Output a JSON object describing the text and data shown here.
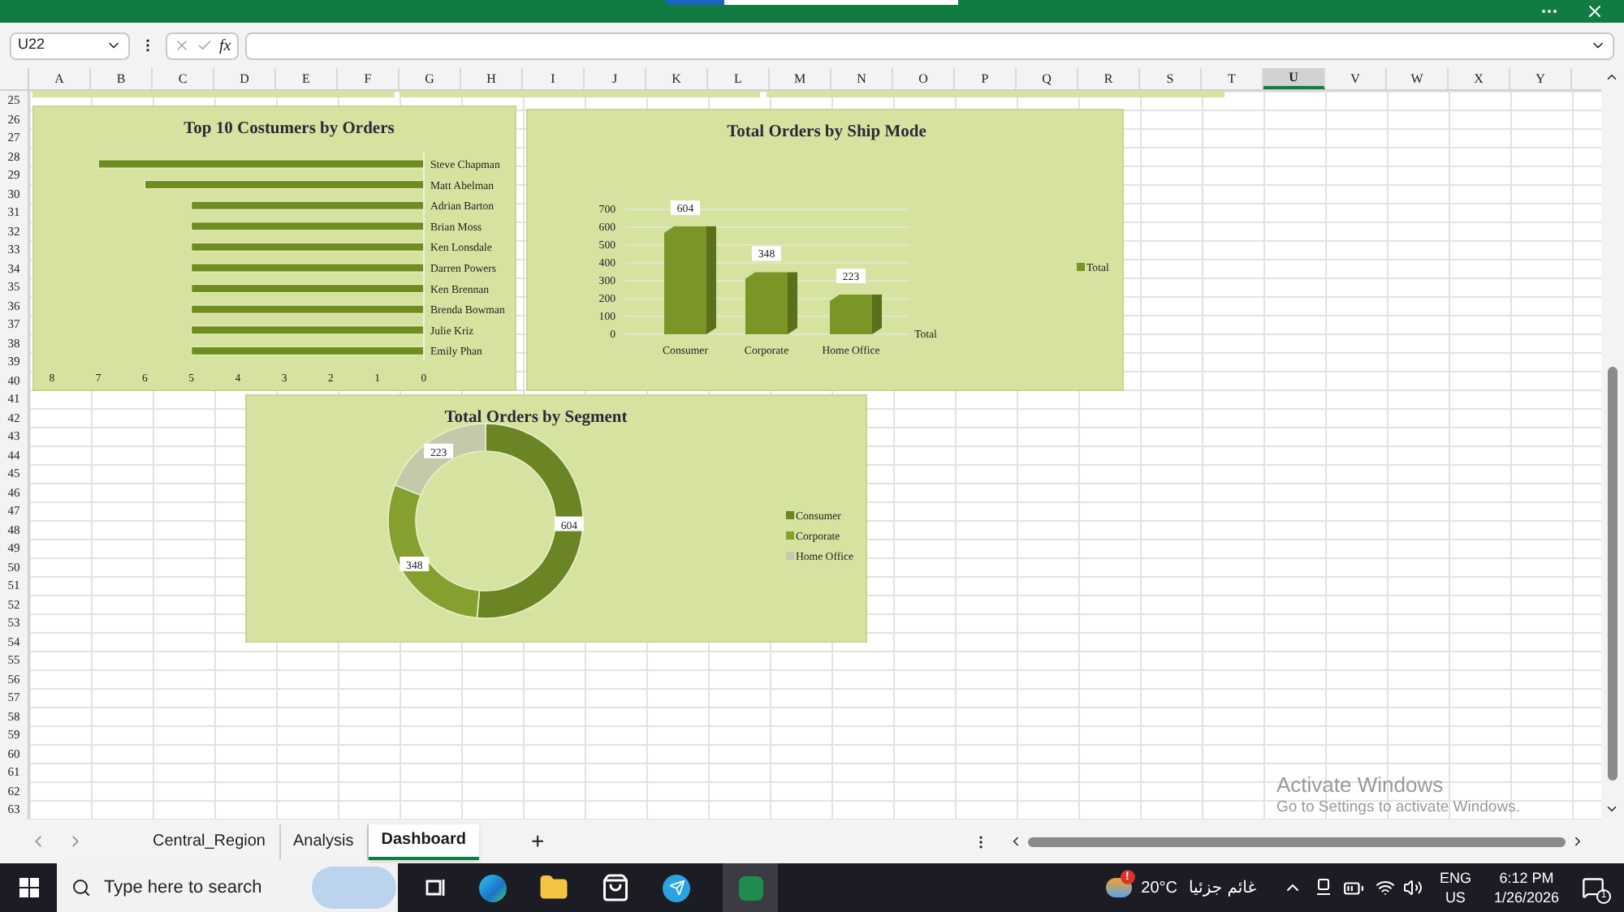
{
  "formula_bar": {
    "name_box": "U22",
    "function_label": "fx"
  },
  "columns": [
    {
      "label": "A",
      "selected": false
    },
    {
      "label": "B",
      "selected": false
    },
    {
      "label": "C",
      "selected": false
    },
    {
      "label": "D",
      "selected": false
    },
    {
      "label": "E",
      "selected": false
    },
    {
      "label": "F",
      "selected": false
    },
    {
      "label": "G",
      "selected": false
    },
    {
      "label": "H",
      "selected": false
    },
    {
      "label": "I",
      "selected": false
    },
    {
      "label": "J",
      "selected": false
    },
    {
      "label": "K",
      "selected": false
    },
    {
      "label": "L",
      "selected": false
    },
    {
      "label": "M",
      "selected": false
    },
    {
      "label": "N",
      "selected": false
    },
    {
      "label": "O",
      "selected": false
    },
    {
      "label": "P",
      "selected": false
    },
    {
      "label": "Q",
      "selected": false
    },
    {
      "label": "R",
      "selected": false
    },
    {
      "label": "S",
      "selected": false
    },
    {
      "label": "T",
      "selected": false
    },
    {
      "label": "U",
      "selected": true
    },
    {
      "label": "V",
      "selected": false
    },
    {
      "label": "W",
      "selected": false
    },
    {
      "label": "X",
      "selected": false
    },
    {
      "label": "Y",
      "selected": false
    }
  ],
  "rows": [
    "25",
    "26",
    "27",
    "28",
    "29",
    "30",
    "31",
    "32",
    "33",
    "34",
    "35",
    "36",
    "37",
    "38",
    "39",
    "40",
    "41",
    "42",
    "43",
    "44",
    "45",
    "46",
    "47",
    "48",
    "49",
    "50",
    "51",
    "52",
    "53",
    "54",
    "55",
    "56",
    "57",
    "58",
    "59",
    "60",
    "61",
    "62",
    "63"
  ],
  "customers_chart": {
    "chart_data": {
      "type": "bar",
      "orientation": "horizontal",
      "title": "Top 10 Costumers by Orders",
      "categories": [
        "Steve Chapman",
        "Matt Abelman",
        "Adrian Barton",
        "Brian Moss",
        "Ken Lonsdale",
        "Darren Powers",
        "Ken Brennan",
        "Brenda Bowman",
        "Julie Kriz",
        "Emily Phan"
      ],
      "values": [
        7,
        6,
        5,
        5,
        5,
        5,
        5,
        5,
        5,
        5
      ],
      "xticks": [
        8,
        7,
        6,
        5,
        4,
        3,
        2,
        1,
        0
      ],
      "xlim": [
        8,
        0
      ]
    }
  },
  "ship_mode_chart": {
    "chart_data": {
      "type": "bar",
      "title": "Total Orders by Ship Mode",
      "categories": [
        "Consumer",
        "Corporate",
        "Home Office"
      ],
      "series": [
        {
          "name": "Total",
          "color": "#7a9626",
          "values": [
            604,
            348,
            223
          ]
        }
      ],
      "yticks": [
        0,
        100,
        200,
        300,
        400,
        500,
        600,
        700
      ],
      "ylim": [
        0,
        700
      ],
      "grid": true,
      "data_labels": true,
      "legend": "right"
    },
    "depth_axis_label": "Total"
  },
  "segment_chart": {
    "chart_data": {
      "type": "donut",
      "title": "Total Orders by Segment",
      "categories": [
        "Consumer",
        "Corporate",
        "Home Office"
      ],
      "series": [
        {
          "values": [
            604,
            348,
            223
          ],
          "colors": [
            "#6b8424",
            "#86a030",
            "#c4caa9"
          ]
        }
      ],
      "data_labels": true,
      "legend": "right"
    }
  },
  "activation_notice": {
    "title": "Activate Windows",
    "subtitle": "Go to Settings to activate Windows."
  },
  "sheet_tabs": [
    {
      "label": "Central_Region",
      "selected": false
    },
    {
      "label": "Analysis",
      "selected": false
    },
    {
      "label": "Dashboard",
      "selected": true
    }
  ],
  "add_sheet": "+",
  "taskbar": {
    "search": {
      "placeholder": "Type here to search"
    },
    "weather": {
      "temperature": "20°C",
      "condition": "غائم جزئيا",
      "alerts": "!"
    },
    "language": "ENG",
    "region": "US",
    "time": "6:12 PM",
    "date": "1/26/2026",
    "notifications": "1"
  }
}
